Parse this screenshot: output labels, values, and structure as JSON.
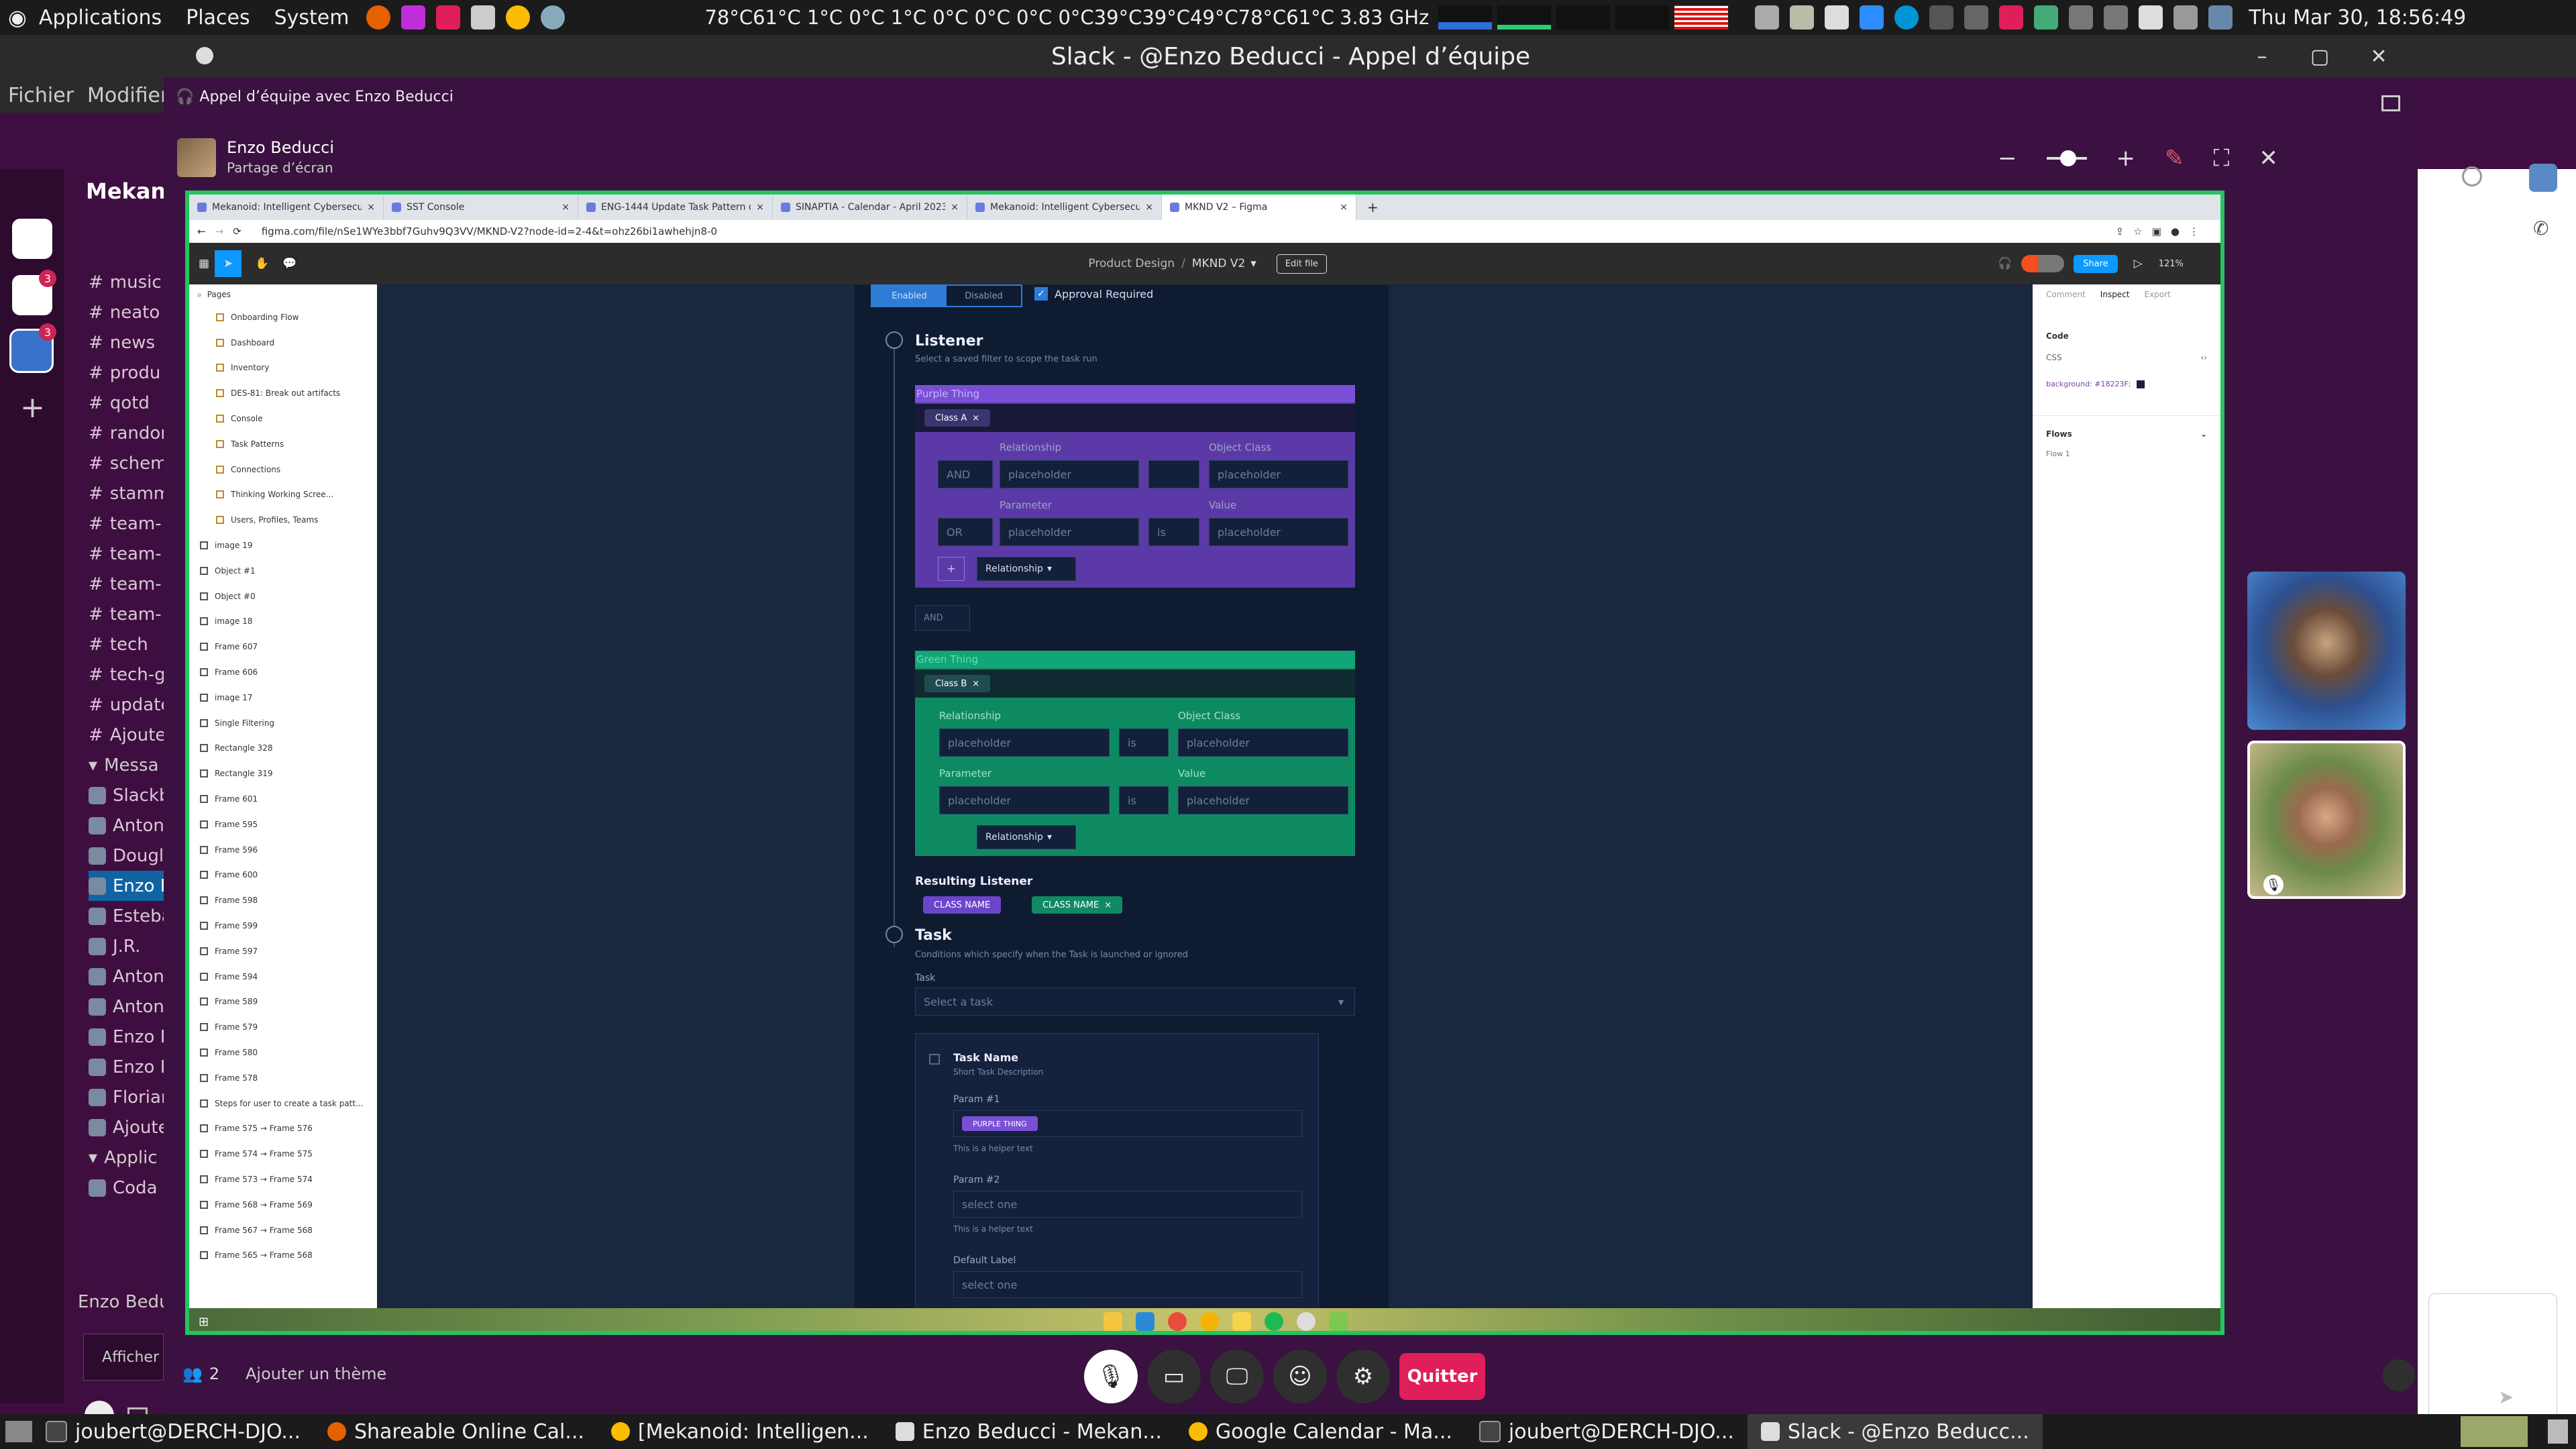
{
  "top_panel": {
    "menus": [
      "Applications",
      "Places",
      "System"
    ],
    "temps": "78°C61°C 1°C 0°C 1°C 0°C 0°C 0°C 0°C39°C39°C49°C78°C61°C",
    "cpu_freq": "3.83 GHz",
    "datetime": "Thu Mar 30, 18:56:49"
  },
  "slack_sidebar": {
    "menus": [
      "Fichier",
      "Modifier"
    ],
    "workspace": "Mekanoi",
    "workspace_badges": [
      "3",
      "3"
    ],
    "channels": [
      "music",
      "neato",
      "news",
      "produ",
      "qotd",
      "randon",
      "schem",
      "stamm",
      "team-",
      "team-",
      "team-",
      "team-",
      "tech",
      "tech-g",
      "update",
      "Ajoute"
    ],
    "section_messages": "Messa",
    "dms": [
      "Slackb",
      "Anton",
      "Dougl",
      "Enzo E",
      "Esteba",
      "J.R.",
      "Anton",
      "Anton",
      "Enzo E",
      "Enzo E",
      "Floriar",
      "Ajoute"
    ],
    "section_apps": "Applic",
    "apps": [
      "Coda"
    ],
    "footer_name": "Enzo Beduc",
    "footer_button": "Afficher"
  },
  "call_window": {
    "title": "Slack - @Enzo Beducci - Appel d’équipe",
    "subheader": "Appel d’équipe avec Enzo Beducci",
    "presenter_name": "Enzo Beducci",
    "presenter_status": "Partage d’écran",
    "participants_count": "2",
    "theme_label": "Ajouter un thème",
    "quit_label": "Quitter"
  },
  "browser": {
    "tabs": [
      "Mekanoid: Intelligent Cybersecu...",
      "SST Console",
      "ENG-1444 Update Task Pattern o...",
      "SINAPTIA - Calendar - April 2023",
      "Mekanoid: Intelligent Cybersecu...",
      "MKND V2 – Figma"
    ],
    "url": "figma.com/file/nSe1WYe3bbf7Guhv9Q3VV/MKND-V2?node-id=2-4&t=ohz26bi1awhehjn8-0"
  },
  "figma": {
    "breadcrumb_project": "Product Design",
    "breadcrumb_file": "MKND V2",
    "edit_file": "Edit file",
    "share": "Share",
    "zoom": "121%",
    "pages_label": "Pages",
    "layers": [
      "Onboarding Flow",
      "Dashboard",
      "Inventory",
      "DES-81: Break out artifacts",
      "Console",
      "Task Patterns",
      "Connections",
      "Thinking Working Scree...",
      "Users, Profiles, Teams",
      "image 19",
      "Object #1",
      "Object #0",
      "image 18",
      "Frame 607",
      "Frame 606",
      "image 17",
      "Single Filtering",
      "Rectangle 328",
      "Rectangle 319",
      "Frame 601",
      "Frame 595",
      "Frame 596",
      "Frame 600",
      "Frame 598",
      "Frame 599",
      "Frame 597",
      "Frame 594",
      "Frame 589",
      "Frame 579",
      "Frame 580",
      "Frame 578",
      "Steps for user to create a task patt...",
      "Frame 575 → Frame 576",
      "Frame 574 → Frame 575",
      "Frame 573 → Frame 574",
      "Frame 568 → Frame 569",
      "Frame 567 → Frame 568",
      "Frame 565 → Frame 568"
    ],
    "inspect_tabs": [
      "Comment",
      "Inspect",
      "Export"
    ],
    "code_label": "Code",
    "css_label": "CSS",
    "css_background": "background: #18223F;",
    "flows_label": "Flows",
    "flow_1": "Flow 1"
  },
  "design": {
    "toggle_enabled": "Enabled",
    "toggle_disabled": "Disabled",
    "approval": "Approval Required",
    "listener_title": "Listener",
    "listener_sub": "Select a saved filter to scope the task run",
    "purple_title": "Purple Thing",
    "purple_chip": "Class A",
    "and_label": "AND",
    "or_label": "OR",
    "is_label": "is",
    "relationship_label": "Relationship",
    "object_class_label": "Object Class",
    "parameter_label": "Parameter",
    "value_label": "Value",
    "placeholder": "placeholder",
    "relationship_button": "Relationship",
    "between_and": "AND",
    "green_title": "Green Thing",
    "green_chip": "Class B",
    "resulting_title": "Resulting Listener",
    "class_name": "CLASS NAME",
    "task_title": "Task",
    "task_sub": "Conditions which specify when the Task is launched or ignored",
    "task_label": "Task",
    "task_select": "Select a task",
    "task_name": "Task Name",
    "task_short": "Short Task Description",
    "param1": "Param #1",
    "param1_chip": "PURPLE THING",
    "helper": "This is a helper text",
    "param2": "Param #2",
    "select_one": "select one",
    "default_label": "Default Label"
  },
  "taskbar": [
    "joubert@DERCH-DJO...",
    "Shareable Online Cal...",
    "[Mekanoid: Intelligen...",
    "Enzo Beducci - Mekan...",
    "Google Calendar - Ma...",
    "joubert@DERCH-DJO...",
    "Slack - @Enzo Beducc..."
  ]
}
